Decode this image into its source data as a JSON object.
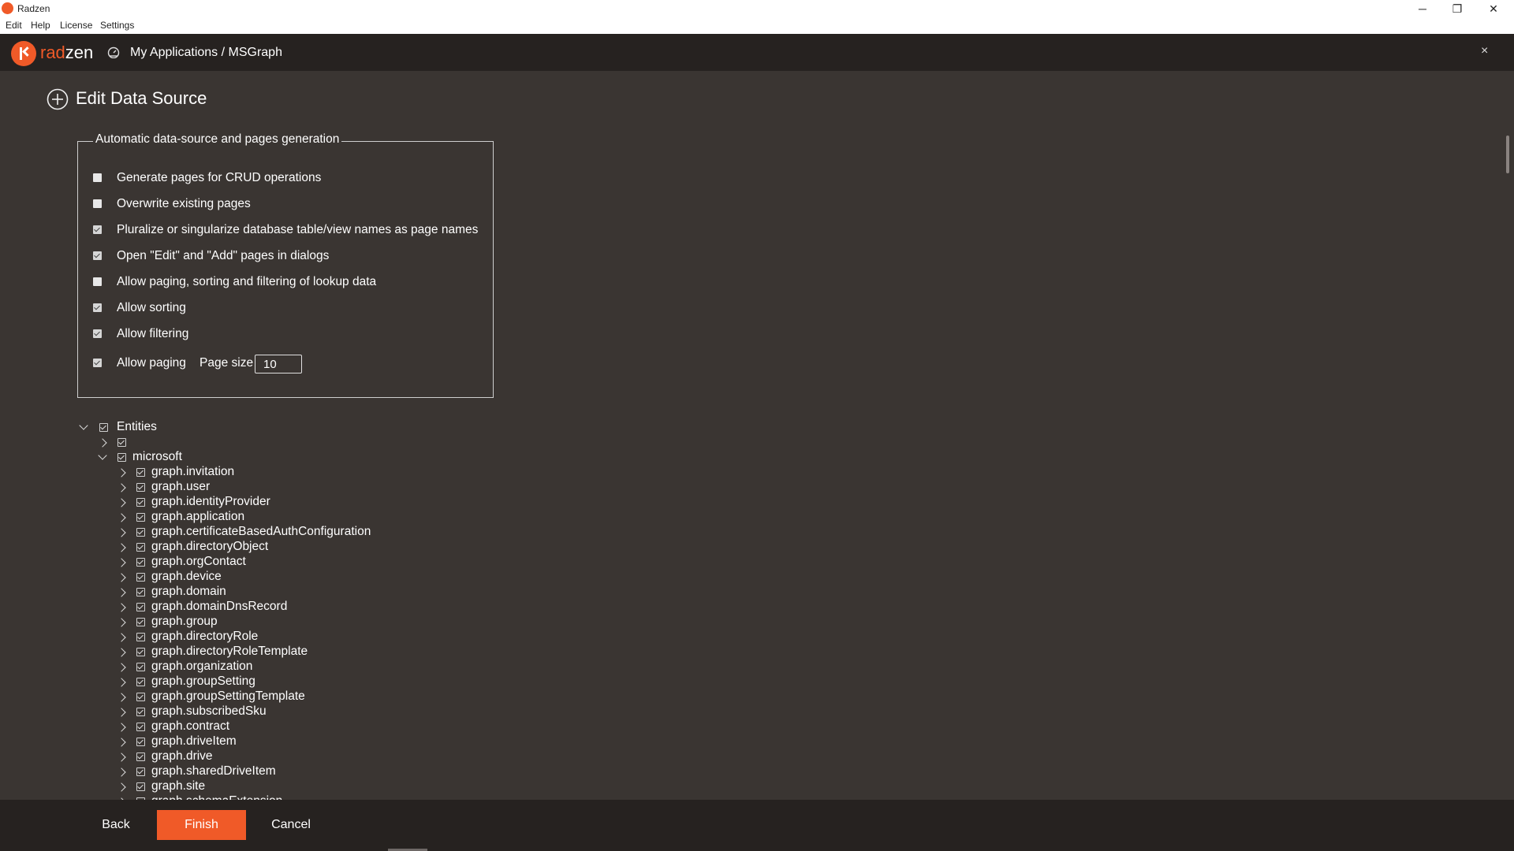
{
  "window": {
    "title": "Radzen",
    "minimize": "─",
    "restore": "❐",
    "close": "✕"
  },
  "menu": [
    "Edit",
    "Help",
    "License",
    "Settings"
  ],
  "header": {
    "logo_prefix": "rad",
    "logo_suffix": "zen",
    "breadcrumb": "My Applications / MSGraph",
    "close": "×"
  },
  "page": {
    "title": "Edit Data Source"
  },
  "generation": {
    "legend": "Automatic data-source and pages generation",
    "options": [
      {
        "label": "Generate pages for CRUD operations",
        "checked": false
      },
      {
        "label": "Overwrite existing pages",
        "checked": false
      },
      {
        "label": "Pluralize or singularize database table/view names as page names",
        "checked": true
      },
      {
        "label": "Open \"Edit\" and \"Add\" pages in dialogs",
        "checked": true
      },
      {
        "label": "Allow paging, sorting and filtering of lookup data",
        "checked": false
      },
      {
        "label": "Allow sorting",
        "checked": true
      },
      {
        "label": "Allow filtering",
        "checked": true
      },
      {
        "label": "Allow paging",
        "checked": true
      }
    ],
    "page_size_label": "Page size",
    "page_size_value": "10"
  },
  "tree": {
    "root": "Entities",
    "unnamed": "",
    "namespace": "microsoft",
    "items": [
      "graph.invitation",
      "graph.user",
      "graph.identityProvider",
      "graph.application",
      "graph.certificateBasedAuthConfiguration",
      "graph.directoryObject",
      "graph.orgContact",
      "graph.device",
      "graph.domain",
      "graph.domainDnsRecord",
      "graph.group",
      "graph.directoryRole",
      "graph.directoryRoleTemplate",
      "graph.organization",
      "graph.groupSetting",
      "graph.groupSettingTemplate",
      "graph.subscribedSku",
      "graph.contract",
      "graph.driveItem",
      "graph.drive",
      "graph.sharedDriveItem",
      "graph.site",
      "graph.schemaExtension"
    ]
  },
  "footer": {
    "back": "Back",
    "finish": "Finish",
    "cancel": "Cancel"
  },
  "colors": {
    "accent": "#f05a28",
    "background": "#3a3532",
    "header": "#262220"
  }
}
